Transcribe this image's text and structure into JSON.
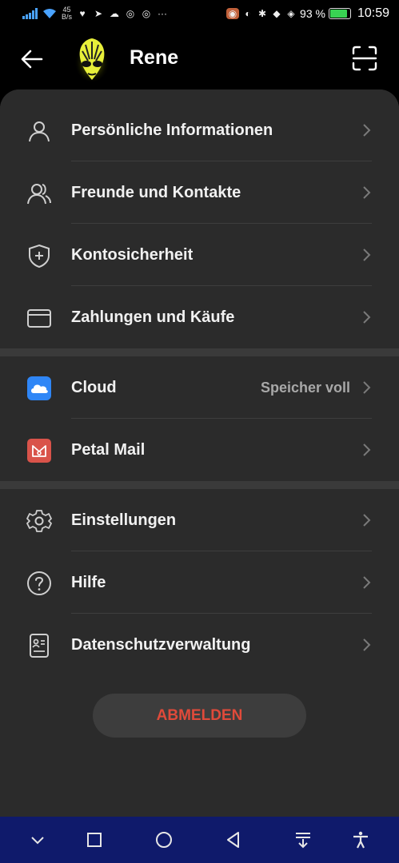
{
  "status_bar": {
    "net_speed_value": "45",
    "net_speed_unit": "B/s",
    "battery_percent": "93 %",
    "battery_level": 0.93,
    "time": "10:59",
    "more": "···"
  },
  "header": {
    "name": "Rene",
    "avatar_icon": "alien-avatar",
    "back_icon": "arrow-left-icon",
    "scan_icon": "scan-icon"
  },
  "groups": [
    [
      {
        "label": "Persönliche Informationen",
        "icon": "person-icon"
      },
      {
        "label": "Freunde und Kontakte",
        "icon": "contacts-icon"
      },
      {
        "label": "Kontosicherheit",
        "icon": "shield-icon"
      },
      {
        "label": "Zahlungen und Käufe",
        "icon": "card-icon"
      }
    ],
    [
      {
        "label": "Cloud",
        "value": "Speicher voll",
        "icon": "cloud-icon"
      },
      {
        "label": "Petal Mail",
        "icon": "mail-icon"
      }
    ],
    [
      {
        "label": "Einstellungen",
        "icon": "gear-icon"
      },
      {
        "label": "Hilfe",
        "icon": "help-icon"
      },
      {
        "label": "Datenschutzverwaltung",
        "icon": "privacy-icon"
      }
    ]
  ],
  "logout_label": "ABMELDEN",
  "colors": {
    "background": "#000000",
    "card": "#2b2b2b",
    "logout_text": "#e04a3a",
    "cloud_blue": "#2f86f6",
    "mail_red": "#d9534a",
    "navbar": "#0f1a6b"
  }
}
